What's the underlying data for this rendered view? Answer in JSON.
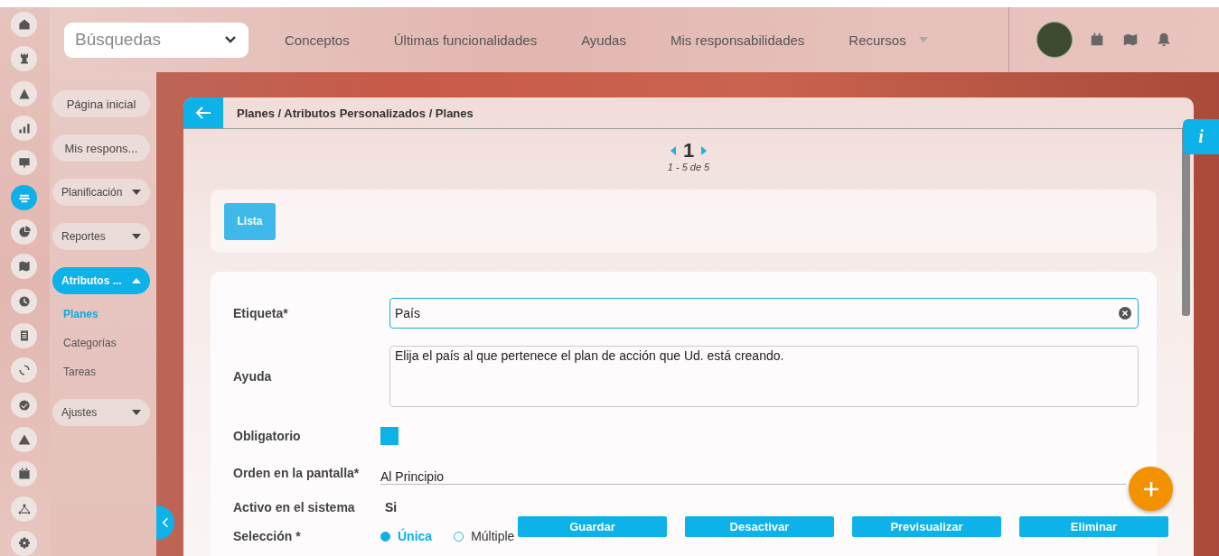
{
  "rail": [
    {
      "selected": false
    },
    {
      "selected": false
    },
    {
      "selected": false
    },
    {
      "selected": false
    },
    {
      "selected": false
    },
    {
      "selected": true
    },
    {
      "selected": false
    },
    {
      "selected": false
    },
    {
      "selected": false
    },
    {
      "selected": false
    },
    {
      "selected": false
    },
    {
      "selected": false
    },
    {
      "selected": false
    },
    {
      "selected": false
    },
    {
      "selected": false
    },
    {
      "selected": false
    }
  ],
  "topbar": {
    "search": {
      "value": "Búsquedas"
    },
    "nav": [
      {
        "label": "Conceptos",
        "has_menu": false
      },
      {
        "label": "Últimas funcionalidades",
        "has_menu": false
      },
      {
        "label": "Ayudas",
        "has_menu": false
      },
      {
        "label": "Mis responsabilidades",
        "has_menu": false
      },
      {
        "label": "Recursos",
        "has_menu": true
      }
    ]
  },
  "sidebar": {
    "items": [
      {
        "label": "Página inicial",
        "kind": "link",
        "selected": false
      },
      {
        "label": "Mis respons...",
        "kind": "link",
        "selected": false
      },
      {
        "label": "Planificación",
        "kind": "menu",
        "expanded": false,
        "selected": false
      },
      {
        "label": "Reportes",
        "kind": "menu",
        "expanded": false,
        "selected": false
      },
      {
        "label": "Atributos ...",
        "kind": "menu",
        "expanded": true,
        "selected": true,
        "children": [
          {
            "label": "Planes",
            "selected": true
          },
          {
            "label": "Categorías",
            "selected": false
          },
          {
            "label": "Tareas",
            "selected": false
          }
        ]
      },
      {
        "label": "Ajustes",
        "kind": "menu",
        "expanded": false,
        "selected": false
      }
    ]
  },
  "breadcrumb": "Planes / Atributos Personalizados / Planes",
  "pager": {
    "page": "1",
    "range": "1 - 5 de 5"
  },
  "toolbar": {
    "buttons": [
      "Lista"
    ]
  },
  "form": {
    "fields": [
      {
        "label": "Etiqueta*",
        "kind": "text",
        "value": "País"
      },
      {
        "label": "Ayuda",
        "kind": "textarea",
        "value": "Elija el país al que pertenece el plan de acción que Ud. está creando."
      },
      {
        "label": "Obligatorio",
        "kind": "checkbox",
        "checked": true
      },
      {
        "label": "Orden en la pantalla*",
        "kind": "select",
        "value": "Al Principio"
      },
      {
        "label": "Activo en el sistema",
        "kind": "static",
        "value": "Si"
      },
      {
        "label": "Selección *",
        "kind": "radio",
        "options": [
          {
            "label": "Única",
            "selected": true
          },
          {
            "label": "Múltiple",
            "selected": false
          }
        ]
      }
    ]
  },
  "actions": [
    "Guardar",
    "Desactivar",
    "Previsualizar",
    "Eliminar"
  ],
  "info_tab": {
    "label": "i"
  }
}
